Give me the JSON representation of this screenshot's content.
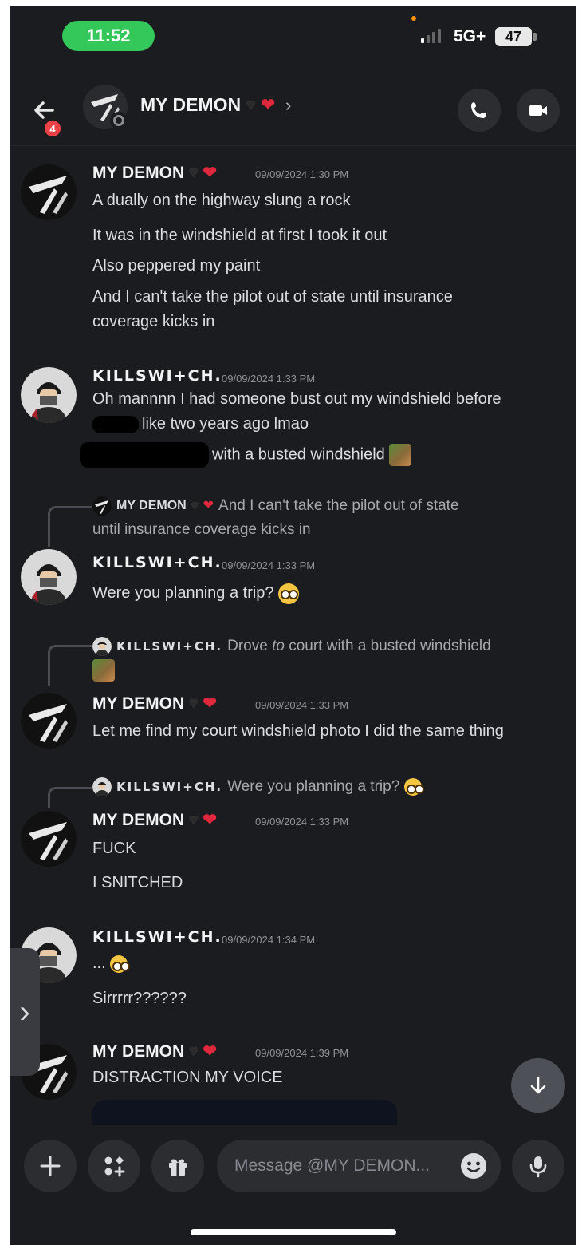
{
  "status_bar": {
    "time": "11:52",
    "network": "5G+",
    "battery": "47"
  },
  "header": {
    "back_badge": "4",
    "title": "MY DEMON",
    "chevron": "›"
  },
  "messages": [
    {
      "author": "MY DEMON",
      "timestamp": "09/09/2024 1:30 PM",
      "lines": [
        "A dually on the highway slung a rock",
        "It was in the windshield at first I took it out",
        "Also peppered my paint",
        "And I can't take the pilot out of state until insurance",
        "coverage kicks in"
      ]
    },
    {
      "author": "KILLSWI+CH.",
      "timestamp": "09/09/2024 1:33 PM",
      "lines": [
        "Oh mannnn I had someone bust out my windshield before",
        "like two years ago lmao",
        "with a busted windshield"
      ]
    },
    {
      "reply": {
        "author": "MY DEMON",
        "text_1": "And I can't take the pilot out of state",
        "text_2": "until insurance coverage kicks in"
      },
      "author": "KILLSWI+CH.",
      "timestamp": "09/09/2024 1:33 PM",
      "lines": [
        "Were you planning a trip?"
      ]
    },
    {
      "reply": {
        "author": "KILLSWI+CH.",
        "text_pre": "Drove ",
        "text_em": "to",
        "text_post": " court with a busted windshield"
      },
      "author": "MY DEMON",
      "timestamp": "09/09/2024 1:33 PM",
      "lines": [
        "Let me find my court windshield photo I did the same thing"
      ]
    },
    {
      "reply": {
        "author": "KILLSWI+CH.",
        "text": "Were you planning a trip?"
      },
      "author": "MY DEMON",
      "timestamp": "09/09/2024 1:33 PM",
      "lines": [
        "FUCK",
        "I SNITCHED"
      ]
    },
    {
      "author": "KILLSWI+CH.",
      "timestamp": "09/09/2024 1:34 PM",
      "lines": [
        "...",
        "Sirrrrr??????"
      ]
    },
    {
      "author": "MY DEMON",
      "timestamp": "09/09/2024 1:39 PM",
      "lines": [
        "DISTRACTION MY VOICE"
      ]
    }
  ],
  "composer": {
    "placeholder": "Message @MY DEMON..."
  },
  "icons": [
    "back-arrow-icon",
    "phone-icon",
    "video-camera-icon",
    "plus-icon",
    "apps-icon",
    "gift-icon",
    "emoji-icon",
    "microphone-icon",
    "arrow-down-icon",
    "chevron-right-icon"
  ],
  "colors": {
    "background": "#1b1c1f",
    "time_pill": "#34c759",
    "badge": "#ed4245",
    "input": "#2b2d31"
  }
}
